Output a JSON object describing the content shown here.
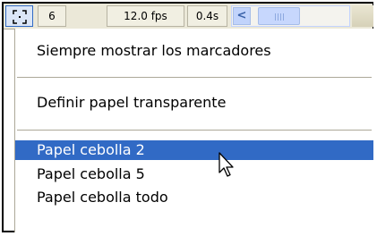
{
  "toolbar": {
    "frames_label": "6",
    "fps_label": "12.0 fps",
    "time_label": "0.4s",
    "scroll_left_glyph": "<",
    "accent": "#316ac5"
  },
  "menu": {
    "items": [
      {
        "label": "Siempre mostrar los marcadores",
        "highlighted": false
      },
      {
        "label": "Definir papel transparente",
        "highlighted": false
      },
      {
        "label": "Papel cebolla 2",
        "highlighted": true
      },
      {
        "label": "Papel cebolla 5",
        "highlighted": false
      },
      {
        "label": "Papel cebolla todo",
        "highlighted": false
      }
    ],
    "highlight_color": "#316ac5"
  },
  "icons": {
    "onion_toggle": "onion-skin-toggle-icon",
    "cursor": "mouse-pointer-icon"
  }
}
